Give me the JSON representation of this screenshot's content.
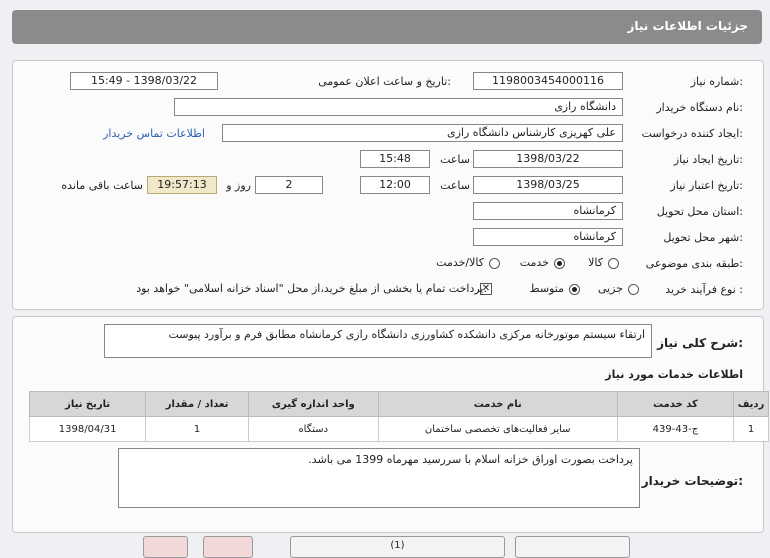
{
  "header": {
    "title": "جزئیات اطلاعات نیاز"
  },
  "form": {
    "need_number_label": "شماره نیاز:",
    "need_number": "1198003454000116",
    "announce_label": "تاریخ و ساعت اعلان عمومی:",
    "announce_value": "1398/03/22 - 15:49",
    "buyer_org_label": "نام دستگاه خریدار:",
    "buyer_org": "دانشگاه رازی",
    "creator_label": "ایجاد کننده درخواست:",
    "creator": "علی کهریزی کارشناس دانشگاه رازی",
    "contact_link": "اطلاعات تماس خریدار",
    "created_date_label": "تاریخ ایجاد نیاز:",
    "created_date": "1398/03/22",
    "time_label": "ساعت",
    "created_time": "15:48",
    "validity_label": "تاریخ اعتبار نیاز:",
    "validity_date": "1398/03/25",
    "validity_time": "12:00",
    "days_value": "2",
    "days_label": "روز و",
    "remaining_value": "19:57:13",
    "remaining_label": "ساعت باقی مانده",
    "province_label": "استان محل تحویل:",
    "province": "کرمانشاه",
    "city_label": "شهر محل تحویل:",
    "city": "کرمانشاه",
    "category_label": "طبقه بندی موضوعی:",
    "category_options": [
      "کالا",
      "خدمت",
      "کالا/خدمت"
    ],
    "category_selected": "خدمت",
    "process_label": "نوع فرآیند خرید :",
    "process_options": [
      "جزیی",
      "متوسط"
    ],
    "process_selected": "متوسط",
    "payment_note": "پرداخت تمام یا بخشی از مبلغ خرید،از محل \"اسناد خزانه اسلامی\" خواهد بود."
  },
  "summary": {
    "label": "شرح کلی نیاز:",
    "text": "ارتقاء سیستم موتورخانه مرکزی دانشکده کشاورزی دانشگاه رازی کرمانشاه مطابق فرم و برآورد پیوست"
  },
  "services": {
    "title": "اطلاعات خدمات مورد نیاز",
    "columns": [
      "ردیف",
      "کد خدمت",
      "نام خدمت",
      "واحد اندازه گیری",
      "تعداد / مقدار",
      "تاریخ نیاز"
    ],
    "rows": [
      [
        "1",
        "ج-43-439",
        "سایر فعالیت‌های تخصصی ساختمان",
        "دستگاه",
        "1",
        "1398/04/31"
      ]
    ]
  },
  "buyer_notes": {
    "label": "توضیحات خریدار:",
    "text": "پرداخت بصورت اوراق خزانه اسلام با سررسید مهرماه 1399 می باشد."
  },
  "footer": {
    "buttons": [
      "",
      "(1)",
      "",
      "",
      ""
    ]
  }
}
